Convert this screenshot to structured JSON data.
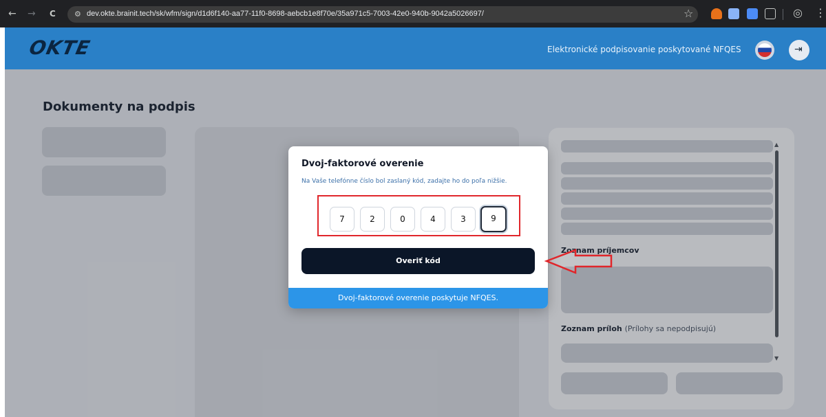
{
  "browser": {
    "url": "dev.okte.brainit.tech/sk/wfm/sign/d1d6f140-aa77-11f0-8698-aebcb1e8f70e/35a971c5-7003-42e0-940b-9042a5026697/",
    "back_icon": "←",
    "forward_icon": "→",
    "reload_icon": "C",
    "site_icon": "⚙",
    "star_icon": "☆",
    "profile_icon": "◎",
    "menu_icon": "⋮"
  },
  "header": {
    "logo": "OKTE",
    "title": "Elektronické podpisovanie poskytované NFQES",
    "logout_icon": "⇥"
  },
  "page": {
    "title": "Dokumenty na podpis",
    "recipients_label": "Zoznam príjemcov",
    "attachments_label": "Zoznam príloh",
    "attachments_note": "(Prílohy sa nepodpisujú)"
  },
  "modal": {
    "title": "Dvoj-faktorové overenie",
    "description": "Na Vaše telefónne číslo bol zaslaný kód, zadajte ho do poľa nižšie.",
    "digits": [
      "7",
      "2",
      "0",
      "4",
      "3",
      "9"
    ],
    "verify_label": "Overiť kód",
    "footer": "Dvoj-faktorové overenie poskytuje NFQES."
  },
  "colors": {
    "header_bg": "#2a80c7",
    "verify_button": "#0b1628",
    "footer_bg": "#2c95e8",
    "highlight": "#e0262b"
  }
}
